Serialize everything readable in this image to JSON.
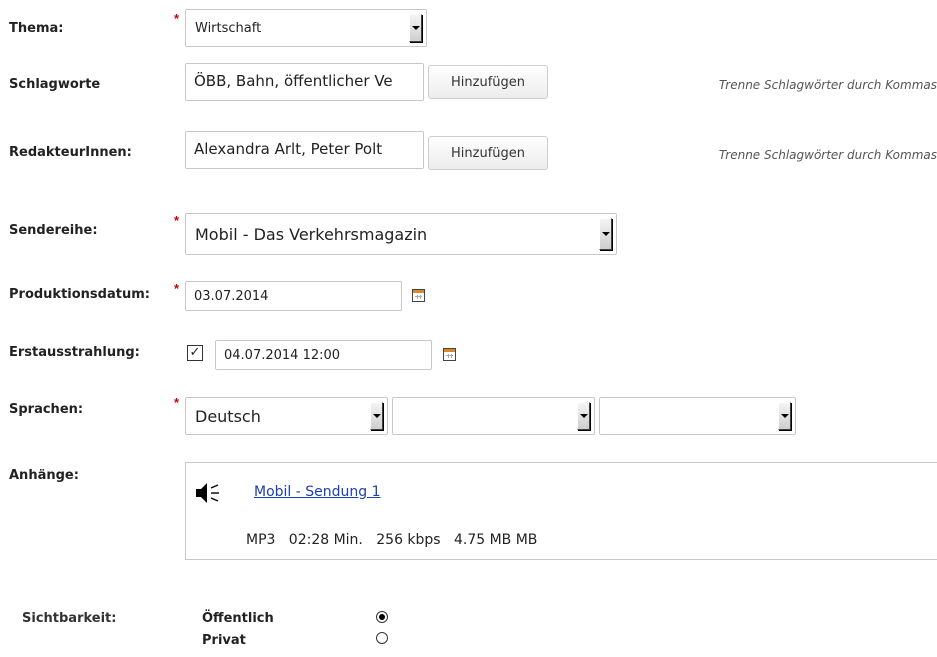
{
  "thema": {
    "label": "Thema:",
    "required_mark": "*",
    "value": "Wirtschaft"
  },
  "schlagworte": {
    "label": "Schlagworte",
    "value": "ÖBB, Bahn, öffentlicher Ve",
    "button": "Hinzufügen",
    "hint": "Trenne Schlagwörter durch Kommas"
  },
  "redakteure": {
    "label": "RedakteurInnen:",
    "value": "Alexandra Arlt, Peter Polt",
    "button": "Hinzufügen",
    "hint": "Trenne Schlagwörter durch Kommas"
  },
  "sendereihe": {
    "label": "Sendereihe:",
    "required_mark": "*",
    "value": "Mobil - Das Verkehrsmagazin"
  },
  "produktionsdatum": {
    "label": "Produktionsdatum:",
    "required_mark": "*",
    "value": "03.07.2014",
    "icon": "calendar-icon"
  },
  "erstausstrahlung": {
    "label": "Erstausstrahlung:",
    "checked": true,
    "checkmark": "✓",
    "value": "04.07.2014 12:00",
    "icon": "calendar-icon"
  },
  "sprachen": {
    "label": "Sprachen:",
    "required_mark": "*",
    "values": [
      "Deutsch",
      "",
      ""
    ]
  },
  "anhaenge": {
    "label": "Anhänge:",
    "icon": "speaker-icon",
    "file_link": "Mobil - Sendung 1",
    "format": "MP3",
    "duration": "02:28 Min.",
    "bitrate": "256 kbps",
    "size": "4.75 MB MB"
  },
  "sichtbarkeit": {
    "label": "Sichtbarkeit:",
    "options": [
      {
        "label": "Öffentlich",
        "selected": true
      },
      {
        "label": "Privat",
        "selected": false
      }
    ]
  },
  "colors": {
    "required": "#d00000",
    "link": "#1a3fb0",
    "field_border": "#c8c8c8"
  }
}
